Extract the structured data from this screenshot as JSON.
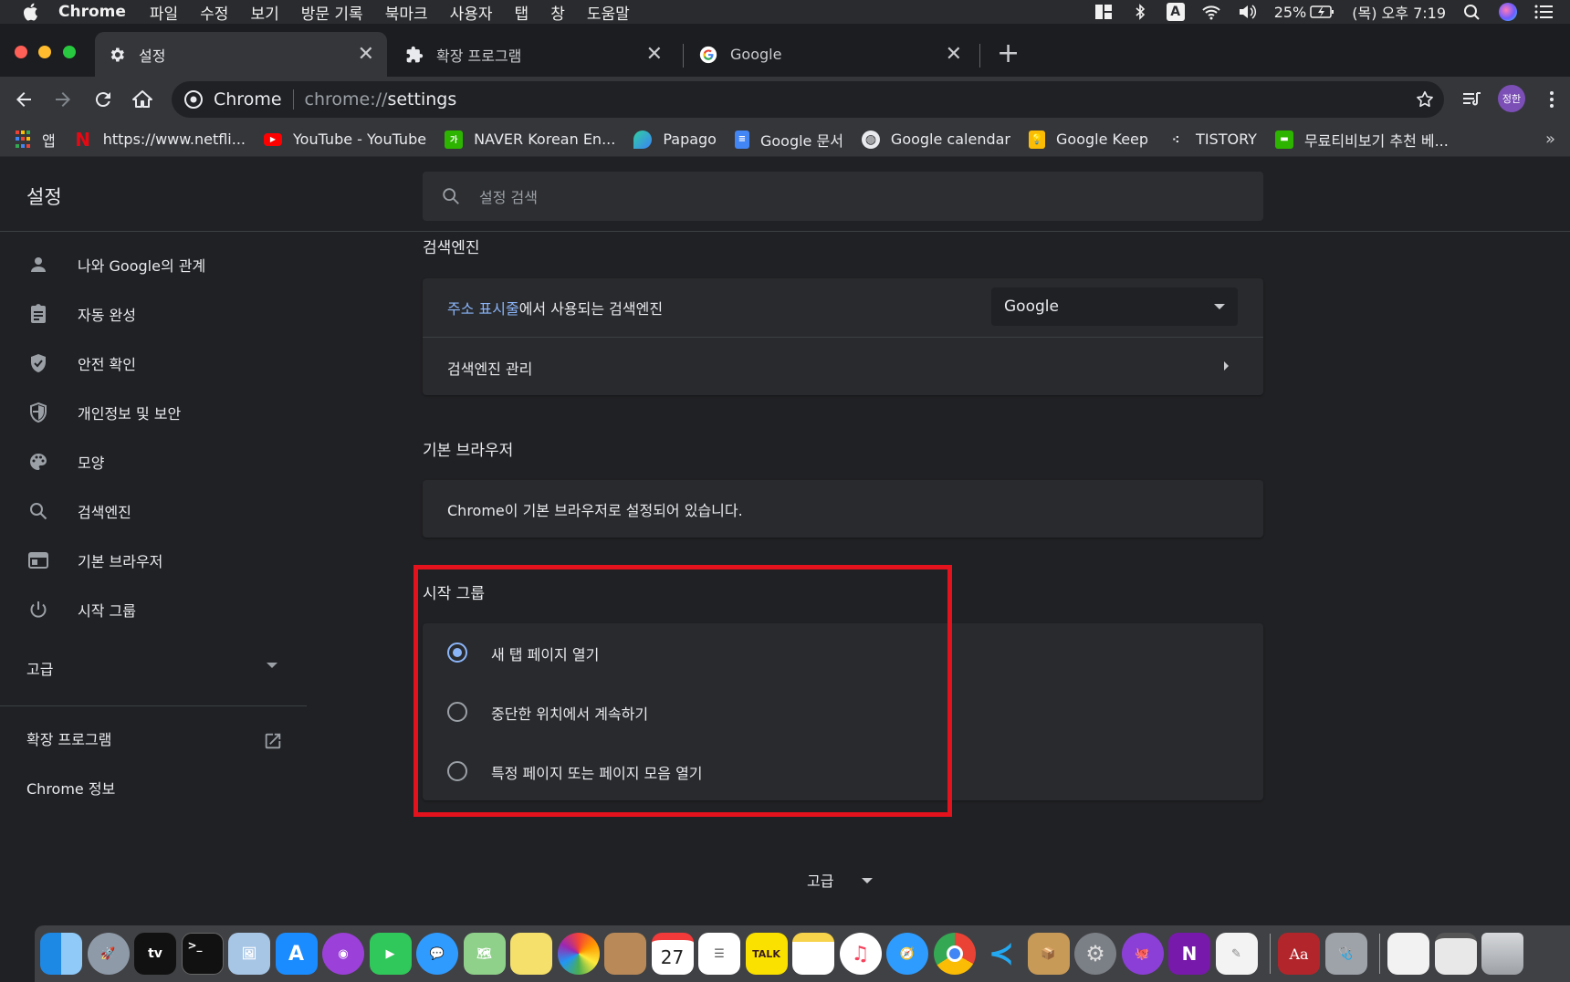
{
  "menubar": {
    "app_name": "Chrome",
    "items": [
      "파일",
      "수정",
      "보기",
      "방문 기록",
      "북마크",
      "사용자",
      "탭",
      "창",
      "도움말"
    ],
    "input_source": "A",
    "battery": "25%",
    "clock": "(목) 오후 7:19"
  },
  "tabs": [
    {
      "title": "설정",
      "icon": "gear-icon",
      "active": true
    },
    {
      "title": "확장 프로그램",
      "icon": "puzzle-icon",
      "active": false
    },
    {
      "title": "Google",
      "icon": "google-g-icon",
      "active": false
    }
  ],
  "toolbar": {
    "site_name": "Chrome",
    "url_scheme": "chrome://",
    "url_path": "settings",
    "profile_initials": "정한"
  },
  "bookmarks": [
    {
      "label": "앱",
      "icon": "apps-grid-icon"
    },
    {
      "label": "https://www.netfli...",
      "icon": "netflix-icon"
    },
    {
      "label": "YouTube - YouTube",
      "icon": "youtube-icon"
    },
    {
      "label": "NAVER Korean En...",
      "icon": "naver-dict-icon"
    },
    {
      "label": "Papago",
      "icon": "papago-icon"
    },
    {
      "label": "Google 문서",
      "icon": "google-docs-icon"
    },
    {
      "label": "Google calendar",
      "icon": "globe-icon"
    },
    {
      "label": "Google Keep",
      "icon": "google-keep-icon"
    },
    {
      "label": "TISTORY",
      "icon": "tistory-icon"
    },
    {
      "label": "무료티비보기 추천 베...",
      "icon": "chat-bubble-icon"
    }
  ],
  "settings": {
    "title": "설정",
    "search_placeholder": "설정 검색"
  },
  "sidebar": {
    "items": [
      {
        "label": "나와 Google의 관계",
        "icon": "person-icon"
      },
      {
        "label": "자동 완성",
        "icon": "clipboard-icon"
      },
      {
        "label": "안전 확인",
        "icon": "shield-check-icon"
      },
      {
        "label": "개인정보 및 보안",
        "icon": "shield-half-icon"
      },
      {
        "label": "모양",
        "icon": "palette-icon"
      },
      {
        "label": "검색엔진",
        "icon": "search-icon"
      },
      {
        "label": "기본 브라우저",
        "icon": "browser-window-icon"
      },
      {
        "label": "시작 그룹",
        "icon": "power-icon"
      }
    ],
    "advanced": "고급",
    "extensions": "확장 프로그램",
    "about": "Chrome 정보"
  },
  "search_engine": {
    "section_title": "검색엔진",
    "row1_link": "주소 표시줄",
    "row1_text": "에서 사용되는 검색엔진",
    "selected": "Google",
    "row2_text": "검색엔진 관리"
  },
  "default_browser": {
    "section_title": "기본 브라우저",
    "status": "Chrome이 기본 브라우저로 설정되어 있습니다."
  },
  "on_startup": {
    "section_title": "시작 그룹",
    "options": [
      {
        "label": "새 탭 페이지 열기",
        "checked": true
      },
      {
        "label": "중단한 위치에서 계속하기",
        "checked": false
      },
      {
        "label": "특정 페이지 또는 페이지 모음 열기",
        "checked": false
      }
    ]
  },
  "bottom_advanced": "고급",
  "dock": {
    "calendar_day": "27",
    "kakao_label": "TALK",
    "dictionary_label": "Aa",
    "onenote_label": "N"
  }
}
